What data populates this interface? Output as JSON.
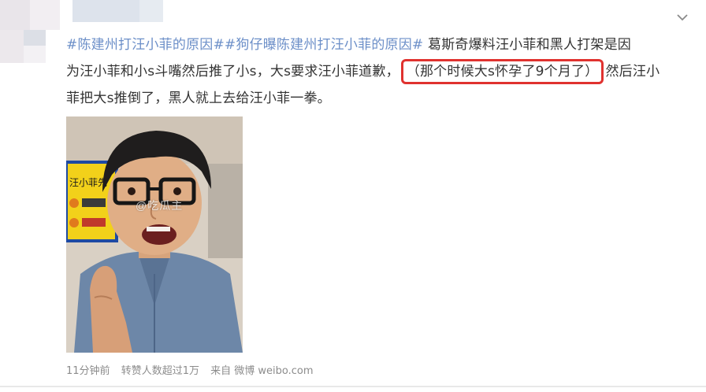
{
  "post": {
    "line1_tag1": "#陈建州打汪小菲的原因#",
    "line1_tag2": "#狗仔曝陈建州打汪小菲的原因#",
    "line1_text": " 葛斯奇爆料汪小菲和黑人打架是因",
    "line2_text_a": "为汪小菲和小s斗嘴然后推了小s，大s要求汪小菲道歉，",
    "line2_boxed": "（那个时候大s怀孕了9个月了）",
    "line2_text_b": "然后汪小",
    "line3_text": "菲把大s推倒了，黑人就上去给汪小菲一拳。"
  },
  "photo": {
    "watermark": "@吃瓜主",
    "sign_text": "汪小菲先"
  },
  "footer": {
    "time": "11分钟前",
    "reposts": "转赞人数超过1万",
    "source": "来自 微博 weibo.com"
  },
  "icons": {
    "menu": "chevron-down-icon"
  },
  "colors": {
    "tag": "#6c8fc8",
    "highlight_border": "#e0322f",
    "text": "#333333",
    "meta": "#8c8c8c"
  }
}
